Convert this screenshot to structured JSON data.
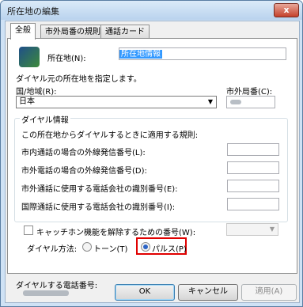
{
  "window": {
    "title": "所在地の編集",
    "close_glyph": "x"
  },
  "tabs": [
    {
      "label": "全般",
      "active": true
    },
    {
      "label": "市外局番の規則",
      "active": false
    },
    {
      "label": "通話カード",
      "active": false
    }
  ],
  "location": {
    "label": "所在地(N):",
    "value": "所在地情報",
    "icon": "globe-phone-icon"
  },
  "specify_text": "ダイヤル元の所在地を指定します。",
  "country": {
    "label": "国/地域(R):",
    "value": "日本"
  },
  "area_code": {
    "label": "市外局番(C):"
  },
  "dialing_rules": {
    "title": "ダイヤル情報",
    "intro": "この所在地からダイヤルするときに適用する規則:",
    "rows": [
      "市内通話の場合の外線発信番号(L):",
      "市外電話の場合の外線発信番号(D):",
      "市外通話に使用する電話会社の識別番号(E):",
      "国際通話に使用する電話会社の識別番号(I):"
    ]
  },
  "call_waiting": {
    "label": "キャッチホン機能を解除するための番号(W):"
  },
  "dial_method": {
    "label": "ダイヤル方法:",
    "tone": "トーン(T)",
    "pulse": "パルス(P)",
    "selected": "pulse"
  },
  "dial_number": {
    "label": "ダイヤルする電話番号:"
  },
  "buttons": {
    "ok": "OK",
    "cancel": "キャンセル",
    "apply": "適用(A)"
  },
  "colors": {
    "highlight": "#e00000",
    "selection": "#3399ff"
  }
}
